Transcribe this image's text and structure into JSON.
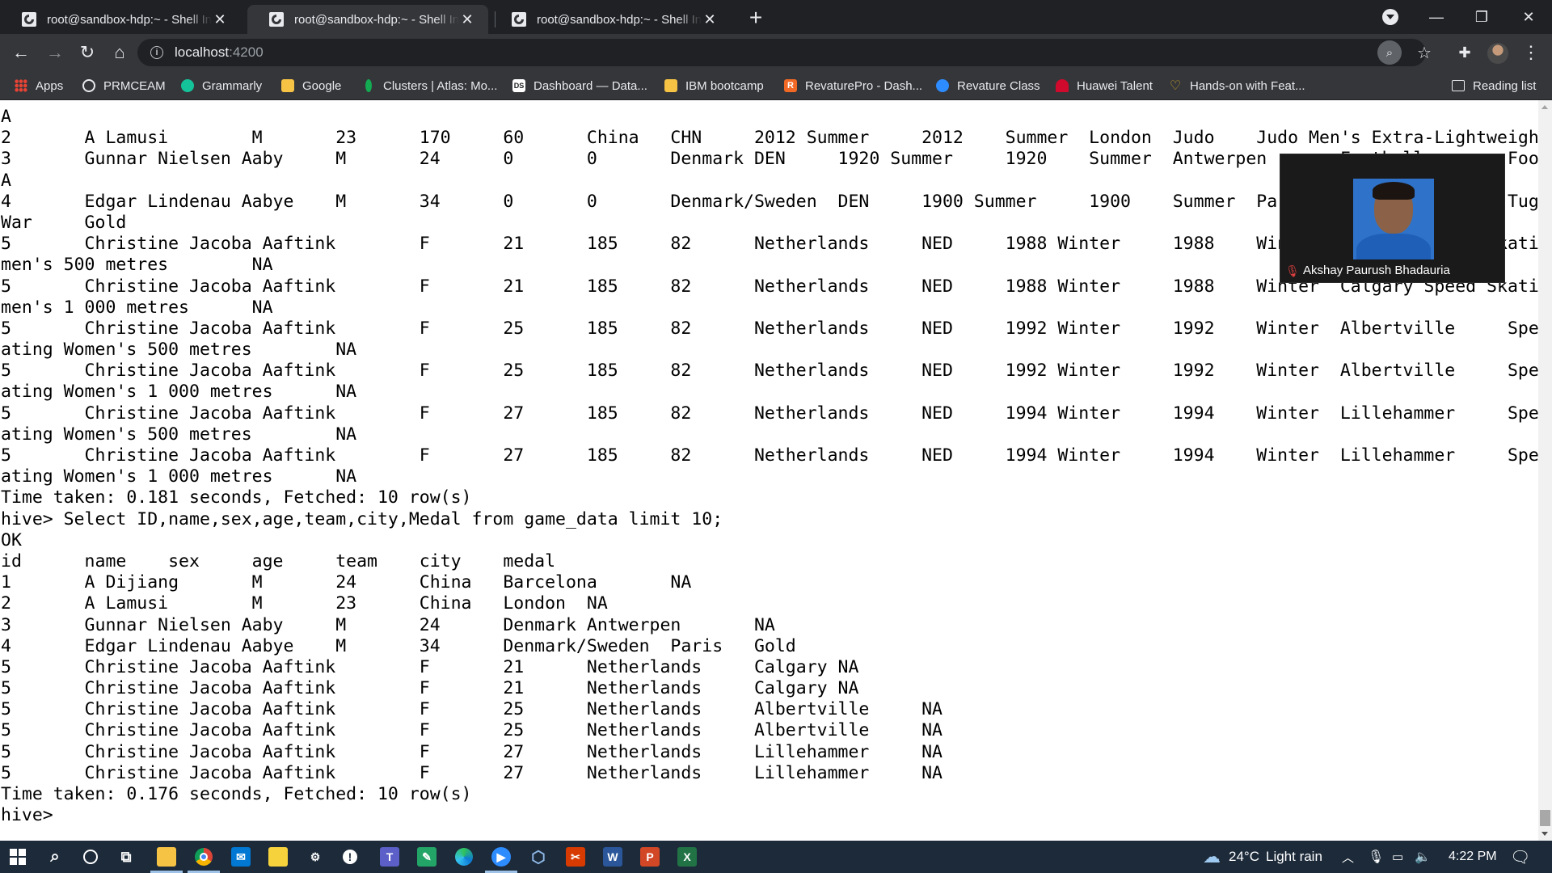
{
  "browser": {
    "tabs": [
      {
        "title": "root@sandbox-hdp:~ - Shell In A",
        "active": false
      },
      {
        "title": "root@sandbox-hdp:~ - Shell In A",
        "active": true
      },
      {
        "title": "root@sandbox-hdp:~ - Shell In A",
        "active": false
      }
    ],
    "new_tab_symbol": "+",
    "url_host": "localhost",
    "url_port": ":4200",
    "bookmarks": [
      {
        "label": "Apps",
        "icon": "apps-grid-icon",
        "color": "#4285f4"
      },
      {
        "label": "PRMCEAM",
        "icon": "globe-icon",
        "color": "#e8eaed"
      },
      {
        "label": "Grammarly",
        "icon": "grammarly-icon",
        "color": "#15c39a"
      },
      {
        "label": "Google",
        "icon": "folder-icon",
        "color": "#f6c344"
      },
      {
        "label": "Clusters | Atlas: Mo...",
        "icon": "mongodb-leaf-icon",
        "color": "#13aa52"
      },
      {
        "label": "Dashboard — Data...",
        "icon": "ds-icon",
        "color": "#ffffff"
      },
      {
        "label": "IBM bootcamp",
        "icon": "folder-icon",
        "color": "#f6c344"
      },
      {
        "label": "RevaturePro - Dash...",
        "icon": "revature-icon",
        "color": "#f26925"
      },
      {
        "label": "Revature Class",
        "icon": "zoom-icon",
        "color": "#2d8cff"
      },
      {
        "label": "Huawei Talent",
        "icon": "huawei-icon",
        "color": "#cf0a2c"
      },
      {
        "label": "Hands-on with Feat...",
        "icon": "heart-icon",
        "color": "#c9a227"
      }
    ],
    "reading_list": "Reading list"
  },
  "terminal": {
    "lines": [
      "A",
      "2       A Lamusi        M       23      170     60      China   CHN     2012 Summer     2012    Summer  London  Judo    Judo Men's Extra-Lightweight    NA",
      "3       Gunnar Nielsen Aaby     M       24      0       0       Denmark DEN     1920 Summer     1920    Summer  Antwerpen       Football        Football Men's",
      "A",
      "4       Edgar Lindenau Aabye    M       34      0       0       Denmark/Sweden  DEN     1900 Summer     1900    Summer  Paris   Tug-Of-War      Tug-Of-War Men",
      "War     Gold",
      "5       Christine Jacoba Aaftink        F       21      185     82      Netherlands     NED     1988 Winter     1988    Winter  Calgary Speed Skating   Speed",
      "men's 500 metres        NA",
      "5       Christine Jacoba Aaftink        F       21      185     82      Netherlands     NED     1988 Winter     1988    Winter  Calgary Speed Skating   Speed",
      "men's 1 000 metres      NA",
      "5       Christine Jacoba Aaftink        F       25      185     82      Netherlands     NED     1992 Winter     1992    Winter  Albertville     Speed Skating",
      "ating Women's 500 metres        NA",
      "5       Christine Jacoba Aaftink        F       25      185     82      Netherlands     NED     1992 Winter     1992    Winter  Albertville     Speed Skating",
      "ating Women's 1 000 metres      NA",
      "5       Christine Jacoba Aaftink        F       27      185     82      Netherlands     NED     1994 Winter     1994    Winter  Lillehammer     Speed Skating",
      "ating Women's 500 metres        NA",
      "5       Christine Jacoba Aaftink        F       27      185     82      Netherlands     NED     1994 Winter     1994    Winter  Lillehammer     Speed Skating",
      "ating Women's 1 000 metres      NA",
      "Time taken: 0.181 seconds, Fetched: 10 row(s)",
      "hive> Select ID,name,sex,age,team,city,Medal from game_data limit 10;",
      "OK",
      "id      name    sex     age     team    city    medal",
      "1       A Dijiang       M       24      China   Barcelona       NA",
      "2       A Lamusi        M       23      China   London  NA",
      "3       Gunnar Nielsen Aaby     M       24      Denmark Antwerpen       NA",
      "4       Edgar Lindenau Aabye    M       34      Denmark/Sweden  Paris   Gold",
      "5       Christine Jacoba Aaftink        F       21      Netherlands     Calgary NA",
      "5       Christine Jacoba Aaftink        F       21      Netherlands     Calgary NA",
      "5       Christine Jacoba Aaftink        F       25      Netherlands     Albertville     NA",
      "5       Christine Jacoba Aaftink        F       25      Netherlands     Albertville     NA",
      "5       Christine Jacoba Aaftink        F       27      Netherlands     Lillehammer     NA",
      "5       Christine Jacoba Aaftink        F       27      Netherlands     Lillehammer     NA",
      "Time taken: 0.176 seconds, Fetched: 10 row(s)",
      "hive> "
    ]
  },
  "video_call": {
    "participant_name": "Akshay Paurush Bhadauria",
    "mic_muted": true
  },
  "taskbar": {
    "weather_temp": "24°C",
    "weather_desc": "Light rain",
    "time": "4:22 PM",
    "apps": [
      "windows-start-icon",
      "search-icon",
      "cortana-icon",
      "task-view-icon",
      "file-explorer-icon",
      "chrome-icon",
      "mail-icon",
      "sticky-notes-icon",
      "settings-icon",
      "unknown-app-icon",
      "teams-icon",
      "whiteboard-icon",
      "edge-icon",
      "zoom-icon",
      "virtualbox-icon",
      "snipping-tool-icon",
      "word-icon",
      "powerpoint-icon",
      "excel-icon"
    ]
  }
}
